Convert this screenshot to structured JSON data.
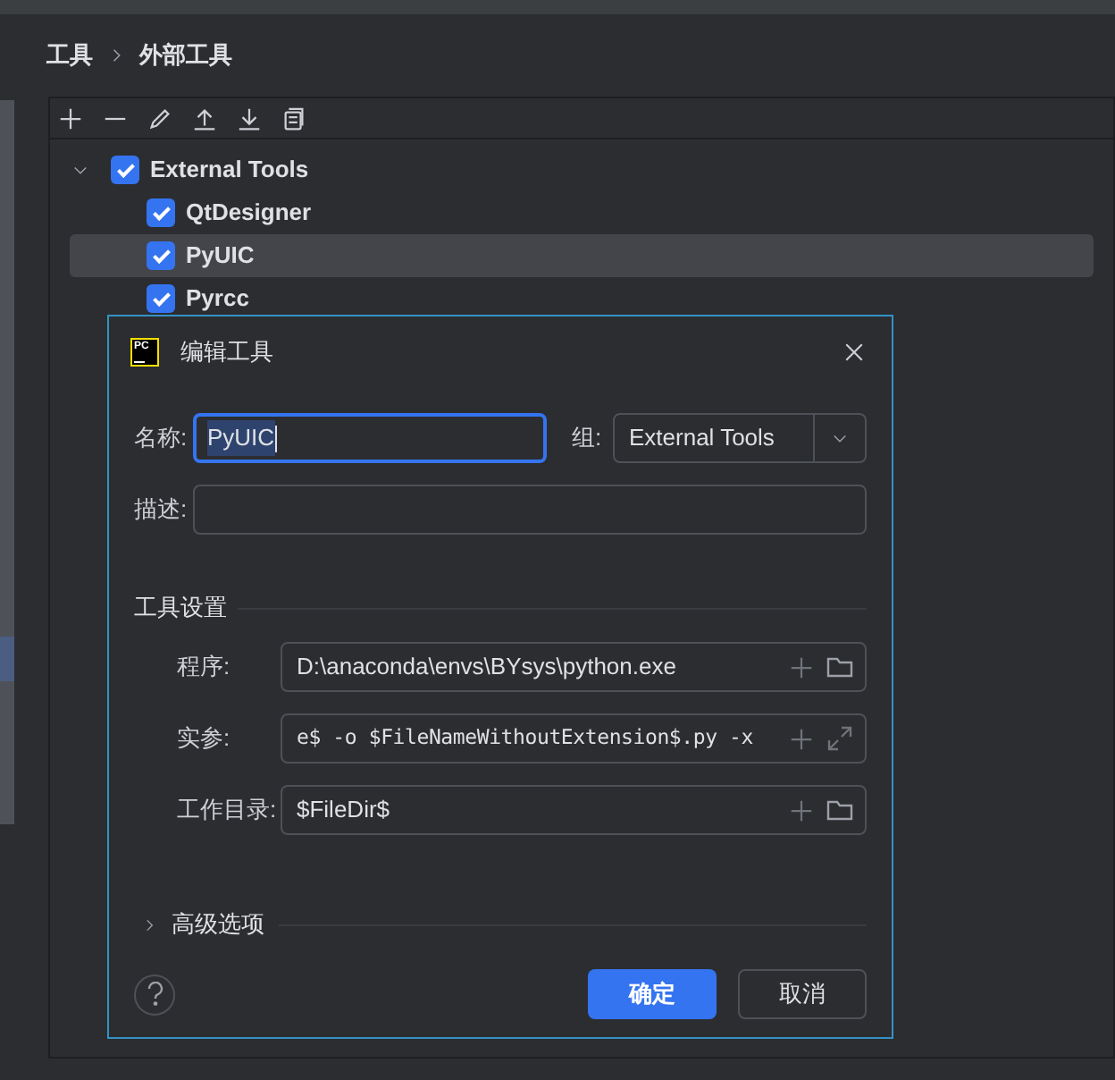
{
  "breadcrumb": [
    "工具",
    "外部工具"
  ],
  "tree": {
    "label": "External Tools",
    "checked": true,
    "expanded": true,
    "children": [
      {
        "label": "QtDesigner",
        "checked": true,
        "selected": false
      },
      {
        "label": "PyUIC",
        "checked": true,
        "selected": true
      },
      {
        "label": "Pyrcc",
        "checked": true,
        "selected": false
      }
    ]
  },
  "dialog": {
    "logo_text": "PC",
    "title": "编辑工具",
    "name": {
      "label": "名称:",
      "value": "PyUIC",
      "text_selected": true
    },
    "group": {
      "label": "组:",
      "value": "External Tools"
    },
    "description": {
      "label": "描述:"
    },
    "section": "工具设置",
    "settings": [
      {
        "label": "程序:",
        "value": "D:\\anaconda\\envs\\BYsys\\python.exe",
        "kind": "browse"
      },
      {
        "label": "实参:",
        "value": "e$ -o $FileNameWithoutExtension$.py -x",
        "kind": "expand"
      },
      {
        "label": "工作目录:",
        "value": "$FileDir$",
        "kind": "browse"
      }
    ],
    "advanced": {
      "label": "高级选项",
      "expanded": false
    },
    "buttons": [
      {
        "label": "确定",
        "kind": "primary"
      },
      {
        "label": "取消",
        "kind": "secondary"
      }
    ]
  }
}
